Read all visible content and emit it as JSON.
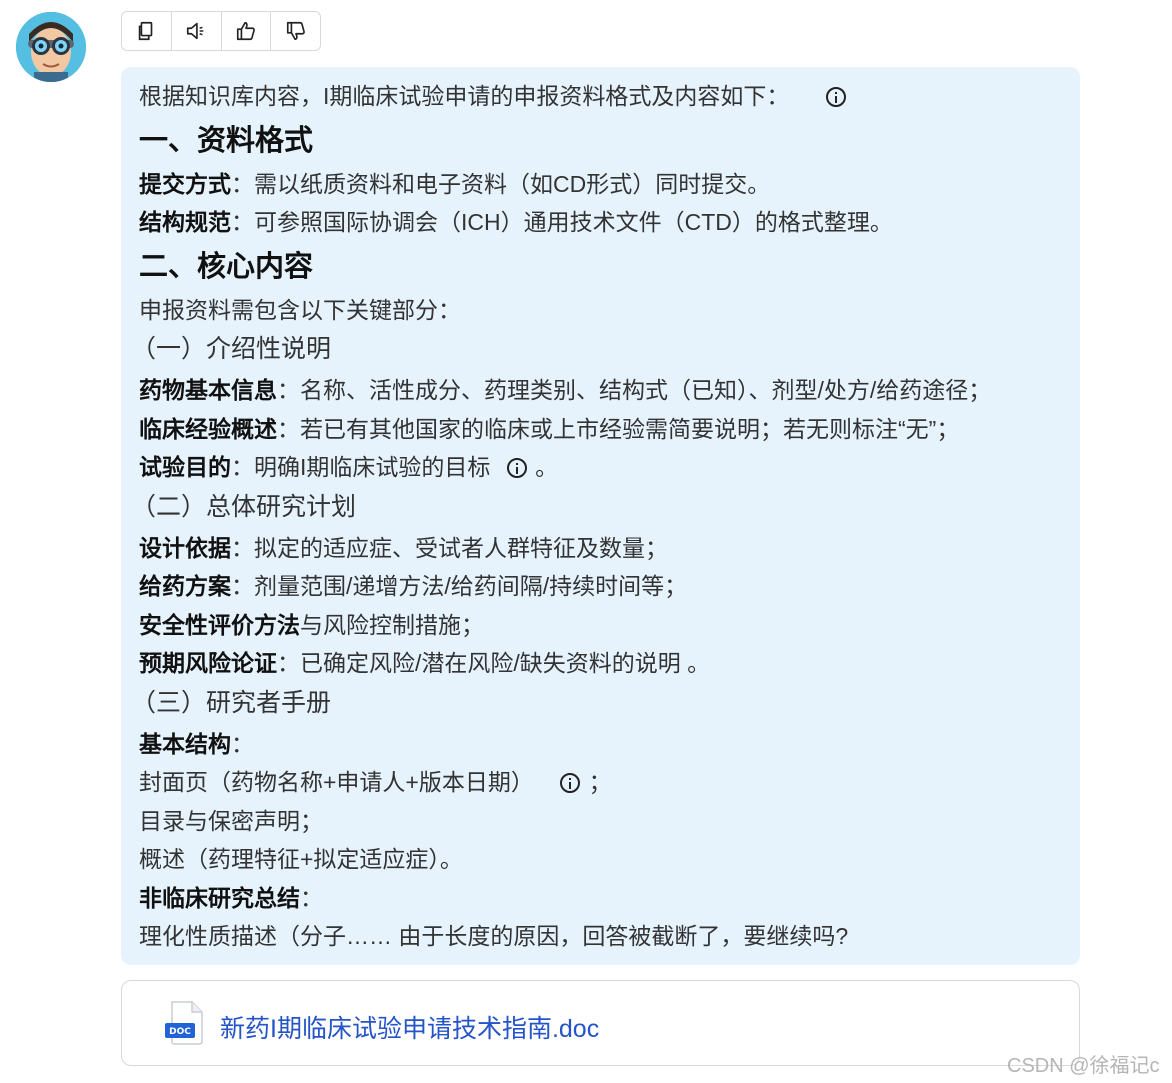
{
  "toolbar": {
    "buttons": [
      {
        "name": "copy-button",
        "icon": "copy-icon"
      },
      {
        "name": "speak-button",
        "icon": "speaker-icon"
      },
      {
        "name": "like-button",
        "icon": "thumbs-up-icon"
      },
      {
        "name": "dislike-button",
        "icon": "thumbs-down-icon"
      }
    ]
  },
  "message": {
    "intro": "根据知识库内容，I期临床试验申请的申报资料格式及内容如下：",
    "section1_title": "一、资料格式",
    "submit_label": "提交方式",
    "submit_text": "：需以纸质资料和电子资料（如CD形式）同时提交。",
    "structure_label": "结构规范",
    "structure_text": "：可参照国际协调会（ICH）通用技术文件（CTD）的格式整理。",
    "section2_title": "二、核心内容",
    "section2_intro": "申报资料需包含以下关键部分：",
    "sub1_title": "（一）介绍性说明",
    "drug_info_label": "药物基本信息",
    "drug_info_text": "：名称、活性成分、药理类别、结构式（已知）、剂型/处方/给药途径；",
    "clinical_label": "临床经验概述",
    "clinical_text": "：若已有其他国家的临床或上市经验需简要说明；若无则标注“无”；",
    "purpose_label": "试验目的",
    "purpose_text": "：明确I期临床试验的目标",
    "purpose_end": "。",
    "sub2_title": "（二）总体研究计划",
    "design_label": "设计依据",
    "design_text": "：拟定的适应症、受试者人群特征及数量；",
    "dosing_label": "给药方案",
    "dosing_text": "：剂量范围/递增方法/给药间隔/持续时间等；",
    "safety_label": "安全性评价方法",
    "safety_text": "与风险控制措施；",
    "risk_label": "预期风险论证",
    "risk_text": "：已确定风险/潜在风险/缺失资料的说明 。",
    "sub3_title": "（三）研究者手册",
    "basic_label": "基本结构",
    "basic_colon": "：",
    "cover_text": "封面页（药物名称+申请人+版本日期）",
    "cover_end": "；",
    "toc_text": "目录与保密声明；",
    "overview_text": "概述（药理特征+拟定适应症）。",
    "nonclinical_label": "非临床研究总结",
    "nonclinical_colon": "：",
    "truncated_text": "理化性质描述（分子…… 由于长度的原因，回答被截断了，要继续吗?"
  },
  "attachment": {
    "badge": "DOC",
    "filename": "新药I期临床试验申请技术指南.doc"
  },
  "watermark": "CSDN @徐福记c",
  "colors": {
    "bubble_bg": "#e6f3fd",
    "link": "#2454c7",
    "doc_badge": "#1f63d6"
  }
}
